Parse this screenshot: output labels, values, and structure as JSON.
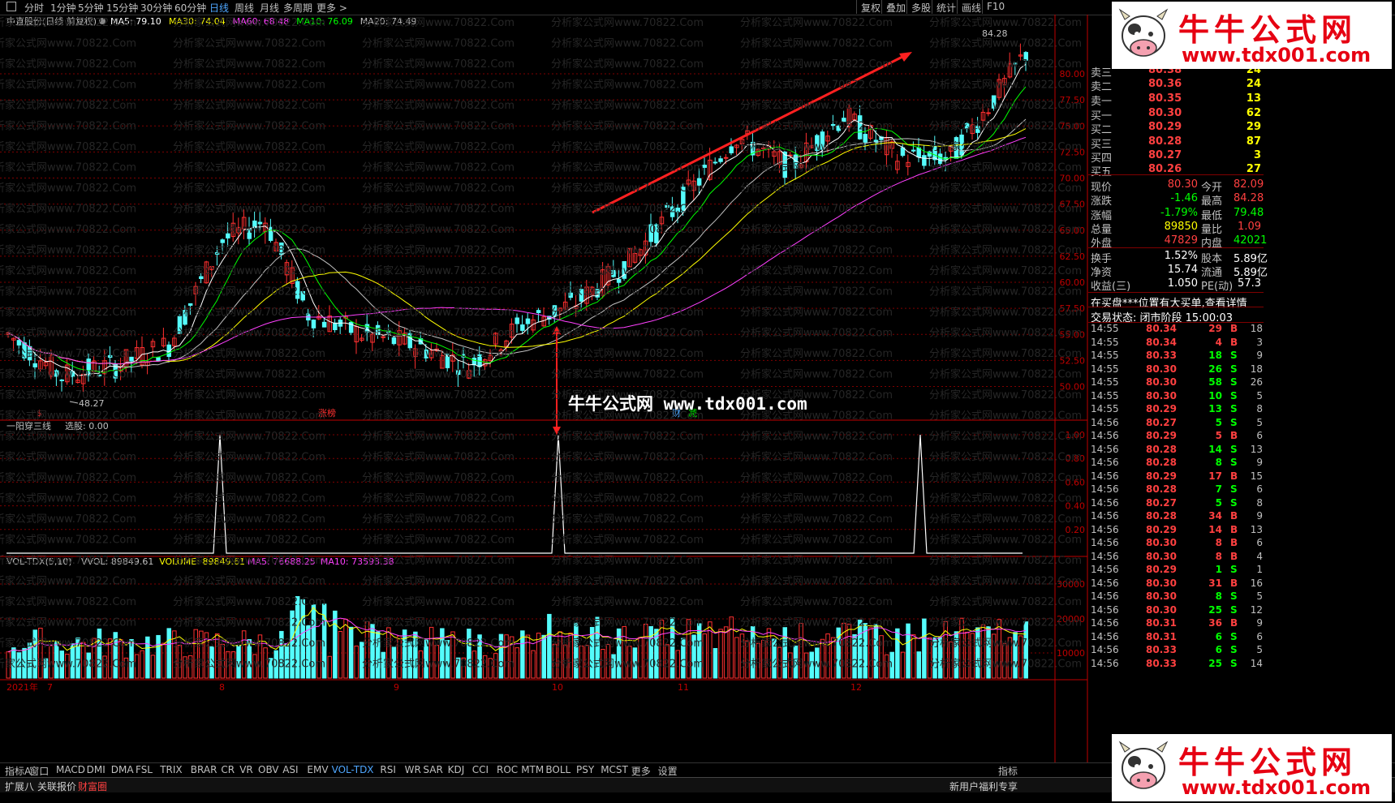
{
  "toolbar": {
    "periods": [
      "分时",
      "1分钟",
      "5分钟",
      "15分钟",
      "30分钟",
      "60分钟",
      "日线",
      "周线",
      "月线",
      "多周期",
      "更多 >"
    ],
    "active_period": "日线",
    "right_buttons": [
      "复权",
      "叠加",
      "多股",
      "统计",
      "画线",
      "F10"
    ]
  },
  "main_chart": {
    "title": "中直股份(日线 前复权)",
    "ma_labels": [
      {
        "text": "MA5: 79.10",
        "color": "#ffffff"
      },
      {
        "text": "MA30: 74.04",
        "color": "#ffff00"
      },
      {
        "text": "MA60: 68.48",
        "color": "#ff40ff"
      },
      {
        "text": "MA10: 76.09",
        "color": "#00ff00"
      },
      {
        "text": "MA20: 74.49",
        "color": "#c0c0c0"
      }
    ],
    "high_label": "84.28",
    "low_label": "48.27",
    "price_ticks": [
      "80.00",
      "77.50",
      "75.00",
      "72.50",
      "70.00",
      "67.50",
      "65.00",
      "62.50",
      "60.00",
      "57.50",
      "55.00",
      "52.50",
      "50.00"
    ],
    "markers": [
      {
        "text": "$",
        "color": "#ff3030"
      },
      {
        "text": "涨榜",
        "color": "#ff3030"
      },
      {
        "text": "财",
        "color": "#4fa7ff"
      },
      {
        "text": "减",
        "color": "#00ff00"
      }
    ]
  },
  "indicator_panel": {
    "title": "一阳穿三线",
    "value_label": "选股: 0.00",
    "ticks": [
      "1.00",
      "0.80",
      "0.60",
      "0.40",
      "0.20"
    ]
  },
  "volume_panel": {
    "title": "VOL-TDX(5,10)",
    "labels": [
      {
        "text": "VVOL: 89849.61",
        "color": "#c0c0c0"
      },
      {
        "text": "VOLUME: 89849.61",
        "color": "#ffff00"
      },
      {
        "text": "MA5: 76688.25",
        "color": "#ff40ff"
      },
      {
        "text": "MA10: 73593.38",
        "color": "#ff40ff"
      }
    ],
    "ticks": [
      "30000",
      "20000",
      "10000"
    ]
  },
  "time_axis": [
    "2021年",
    "7",
    "8",
    "9",
    "10",
    "11",
    "12"
  ],
  "order_book": {
    "sells": [
      {
        "label": "卖三",
        "price": "80.38",
        "vol": "24"
      },
      {
        "label": "卖二",
        "price": "80.36",
        "vol": "24"
      },
      {
        "label": "卖一",
        "price": "80.35",
        "vol": "13"
      }
    ],
    "buys": [
      {
        "label": "买一",
        "price": "80.30",
        "vol": "62"
      },
      {
        "label": "买二",
        "price": "80.29",
        "vol": "29"
      },
      {
        "label": "买三",
        "price": "80.28",
        "vol": "87"
      },
      {
        "label": "买四",
        "price": "80.27",
        "vol": "3"
      },
      {
        "label": "买五",
        "price": "80.26",
        "vol": "27"
      }
    ]
  },
  "quote_stats": [
    {
      "l1": "现价",
      "v1": "80.30",
      "c1": "#ff4040",
      "l2": "今开",
      "v2": "82.09",
      "c2": "#ff4040"
    },
    {
      "l1": "涨跌",
      "v1": "-1.46",
      "c1": "#00ff00",
      "l2": "最高",
      "v2": "84.28",
      "c2": "#ff4040"
    },
    {
      "l1": "涨幅",
      "v1": "-1.79%",
      "c1": "#00ff00",
      "l2": "最低",
      "v2": "79.48",
      "c2": "#00ff00"
    },
    {
      "l1": "总量",
      "v1": "89850",
      "c1": "#ffff00",
      "l2": "量比",
      "v2": "1.09",
      "c2": "#ff4040"
    },
    {
      "l1": "外盘",
      "v1": "47829",
      "c1": "#ff4040",
      "l2": "内盘",
      "v2": "42021",
      "c2": "#00ff00"
    },
    {
      "l1": "换手",
      "v1": "1.52%",
      "c1": "#ffffff",
      "l2": "股本",
      "v2": "5.89亿",
      "c2": "#ffffff"
    },
    {
      "l1": "净资",
      "v1": "15.74",
      "c1": "#ffffff",
      "l2": "流通",
      "v2": "5.89亿",
      "c2": "#ffffff"
    },
    {
      "l1": "收益(三)",
      "v1": "1.050",
      "c1": "#ffffff",
      "l2": "PE(动)",
      "v2": "57.3",
      "c2": "#ffffff"
    }
  ],
  "notice": "在买盘***位置有大买单,查看详情",
  "trade_status": "交易状态: 闭市阶段 15:00:03",
  "ticks": [
    {
      "t": "14:55",
      "p": "80.34",
      "v": "29",
      "bs": "B",
      "n": "18"
    },
    {
      "t": "14:55",
      "p": "80.34",
      "v": "4",
      "bs": "B",
      "n": "3"
    },
    {
      "t": "14:55",
      "p": "80.33",
      "v": "18",
      "bs": "S",
      "n": "9"
    },
    {
      "t": "14:55",
      "p": "80.30",
      "v": "26",
      "bs": "S",
      "n": "18"
    },
    {
      "t": "14:55",
      "p": "80.30",
      "v": "58",
      "bs": "S",
      "n": "26"
    },
    {
      "t": "14:55",
      "p": "80.30",
      "v": "10",
      "bs": "S",
      "n": "5"
    },
    {
      "t": "14:55",
      "p": "80.29",
      "v": "13",
      "bs": "S",
      "n": "8"
    },
    {
      "t": "14:56",
      "p": "80.27",
      "v": "5",
      "bs": "S",
      "n": "5"
    },
    {
      "t": "14:56",
      "p": "80.29",
      "v": "5",
      "bs": "B",
      "n": "6"
    },
    {
      "t": "14:56",
      "p": "80.28",
      "v": "14",
      "bs": "S",
      "n": "13"
    },
    {
      "t": "14:56",
      "p": "80.28",
      "v": "8",
      "bs": "S",
      "n": "9"
    },
    {
      "t": "14:56",
      "p": "80.29",
      "v": "17",
      "bs": "B",
      "n": "15"
    },
    {
      "t": "14:56",
      "p": "80.28",
      "v": "7",
      "bs": "S",
      "n": "6"
    },
    {
      "t": "14:56",
      "p": "80.27",
      "v": "5",
      "bs": "S",
      "n": "8"
    },
    {
      "t": "14:56",
      "p": "80.28",
      "v": "34",
      "bs": "B",
      "n": "9"
    },
    {
      "t": "14:56",
      "p": "80.29",
      "v": "14",
      "bs": "B",
      "n": "13"
    },
    {
      "t": "14:56",
      "p": "80.30",
      "v": "8",
      "bs": "B",
      "n": "6"
    },
    {
      "t": "14:56",
      "p": "80.30",
      "v": "8",
      "bs": "B",
      "n": "4"
    },
    {
      "t": "14:56",
      "p": "80.29",
      "v": "1",
      "bs": "S",
      "n": "1"
    },
    {
      "t": "14:56",
      "p": "80.30",
      "v": "31",
      "bs": "B",
      "n": "16"
    },
    {
      "t": "14:56",
      "p": "80.30",
      "v": "8",
      "bs": "S",
      "n": "5"
    },
    {
      "t": "14:56",
      "p": "80.30",
      "v": "25",
      "bs": "S",
      "n": "12"
    },
    {
      "t": "14:56",
      "p": "80.31",
      "v": "36",
      "bs": "B",
      "n": "9"
    },
    {
      "t": "14:56",
      "p": "80.31",
      "v": "6",
      "bs": "S",
      "n": "6"
    },
    {
      "t": "14:56",
      "p": "80.33",
      "v": "6",
      "bs": "S",
      "n": "5"
    },
    {
      "t": "14:56",
      "p": "80.33",
      "v": "25",
      "bs": "S",
      "n": "14"
    }
  ],
  "indicator_tabs": [
    "指标A",
    "窗口",
    "MACD",
    "DMI",
    "DMA",
    "FSL",
    "TRIX",
    "BRAR",
    "CR",
    "VR",
    "OBV",
    "ASI",
    "EMV",
    "VOL-TDX",
    "RSI",
    "WR",
    "SAR",
    "KDJ",
    "CCI",
    "ROC",
    "MTM",
    "BOLL",
    "PSY",
    "MCST",
    "更多",
    "设置"
  ],
  "active_indicator": "VOL-TDX",
  "status_items": [
    "扩展八",
    "关联报价",
    "财富圈"
  ],
  "status_right": "新用户福利专享",
  "status_right2": "指标",
  "watermark_center": "牛牛公式网 www.tdx001.com",
  "logo": {
    "title": "牛牛公式网",
    "url": "www.tdx001.com"
  },
  "watermark_repeat": "分析家公式网www.70822.Com",
  "colors": {
    "up": "#ff3030",
    "down": "#54fcfc",
    "grid": "#800000",
    "axis": "#c00000"
  }
}
